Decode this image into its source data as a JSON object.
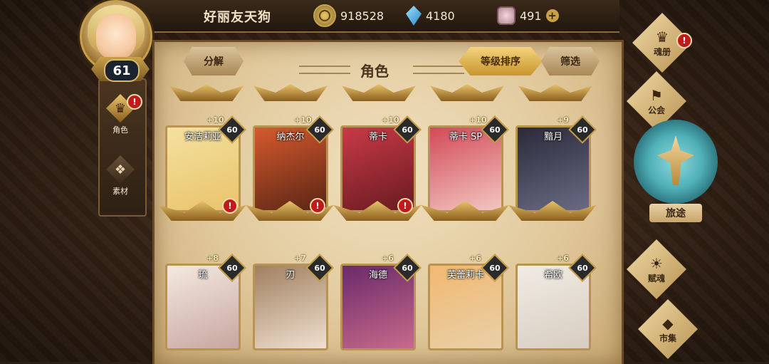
{
  "player": {
    "name": "好丽友天狗",
    "level": "61"
  },
  "currencies": [
    {
      "name": "gold",
      "value": "918528"
    },
    {
      "name": "gem",
      "value": "4180"
    },
    {
      "name": "crystal",
      "value": "491"
    }
  ],
  "left_tabs": [
    {
      "label": "角色",
      "active": true,
      "alert": "!"
    },
    {
      "label": "素材",
      "active": false
    }
  ],
  "page": {
    "title": "角色",
    "decompose_label": "分解",
    "sort_label": "等级排序",
    "filter_label": "筛选"
  },
  "characters_row1": [
    {
      "name": "安洁莉亚",
      "plus": "+10",
      "level": "60",
      "alert": "!",
      "colors": [
        "#f4e1a0",
        "#e9c36a"
      ]
    },
    {
      "name": "纳杰尔",
      "plus": "+10",
      "level": "60",
      "alert": "!",
      "colors": [
        "#d65a2e",
        "#5a2514"
      ]
    },
    {
      "name": "蒂卡",
      "plus": "+10",
      "level": "60",
      "alert": "!",
      "colors": [
        "#c83a48",
        "#6a1a20"
      ]
    },
    {
      "name": "蒂卡 SP",
      "plus": "+10",
      "level": "60",
      "alert": "",
      "colors": [
        "#d24a58",
        "#f3c6c0"
      ]
    },
    {
      "name": "黯月",
      "plus": "+9",
      "level": "60",
      "alert": "",
      "colors": [
        "#2a2a3a",
        "#6a6a84"
      ]
    }
  ],
  "characters_row2": [
    {
      "name": "琉",
      "plus": "+8",
      "level": "60",
      "colors": [
        "#f3e9e0",
        "#c8a6a0"
      ]
    },
    {
      "name": "刃",
      "plus": "+7",
      "level": "60",
      "colors": [
        "#a08060",
        "#f0e0d0"
      ]
    },
    {
      "name": "海德",
      "plus": "+6",
      "level": "60",
      "colors": [
        "#6a2a6a",
        "#c86a8a"
      ]
    },
    {
      "name": "芙蕾莉卡",
      "plus": "+6",
      "level": "60",
      "colors": [
        "#f2b870",
        "#e8d0a8"
      ]
    },
    {
      "name": "希欧",
      "plus": "+6",
      "level": "60",
      "colors": [
        "#f0ece4",
        "#d8ccc0"
      ]
    }
  ],
  "right_nav": [
    {
      "label": "魂册",
      "icon": "book-icon",
      "alert": "!"
    },
    {
      "label": "公会",
      "icon": "guild-icon"
    },
    {
      "label": "旅途",
      "icon": "journey-emblem-icon"
    },
    {
      "label": "赋魂",
      "icon": "soul-icon"
    },
    {
      "label": "市集",
      "icon": "market-icon"
    }
  ]
}
